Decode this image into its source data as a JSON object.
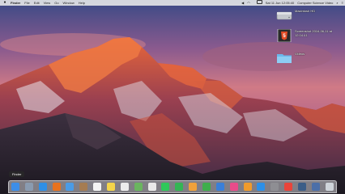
{
  "menubar": {
    "apple_icon": "apple-logo-icon",
    "items": [
      "Finder",
      "File",
      "Edit",
      "View",
      "Go",
      "Window",
      "Help"
    ],
    "clock": "Sat 11 Jun 12:05:40",
    "user": "Computer Science Video",
    "status_icons": [
      "battery-icon",
      "wifi-icon",
      "volume-icon",
      "search-icon",
      "notification-center-icon"
    ]
  },
  "desktop_items": [
    {
      "icon": "hard-drive-icon",
      "label": "Macintosh HD",
      "color": "#b9bcc2"
    },
    {
      "icon": "screenshot-thumbnail-icon",
      "label": "Screenshot 2016-06-11 at 12.04.41",
      "color": "#e34c26"
    },
    {
      "icon": "folder-icon",
      "label": "Videos",
      "color": "#7dc4f0"
    }
  ],
  "tooltip": "Finder",
  "dock": {
    "apps": [
      {
        "name": "finder",
        "icon": "finder-icon",
        "color": "#3d8ee8"
      },
      {
        "name": "launchpad",
        "icon": "rocket-icon",
        "color": "#8a9bb0"
      },
      {
        "name": "safari",
        "icon": "compass-icon",
        "color": "#2f8fe6"
      },
      {
        "name": "firefox",
        "icon": "fox-icon",
        "color": "#e8721e"
      },
      {
        "name": "mail",
        "icon": "envelope-icon",
        "color": "#4a9be6"
      },
      {
        "name": "contacts",
        "icon": "address-book-icon",
        "color": "#a57c52"
      },
      {
        "name": "calendar",
        "icon": "calendar-icon",
        "color": "#f4f4f4"
      },
      {
        "name": "notes",
        "icon": "notes-icon",
        "color": "#f3d44a"
      },
      {
        "name": "reminders",
        "icon": "checklist-icon",
        "color": "#ececec"
      },
      {
        "name": "maps",
        "icon": "map-icon",
        "color": "#6ab55f"
      },
      {
        "name": "photos",
        "icon": "photo-flower-icon",
        "color": "#e9e9e9"
      },
      {
        "name": "messages",
        "icon": "speech-bubble-icon",
        "color": "#2fc85a"
      },
      {
        "name": "facetime",
        "icon": "video-camera-icon",
        "color": "#34b554"
      },
      {
        "name": "pages",
        "icon": "document-icon",
        "color": "#f0a13a"
      },
      {
        "name": "numbers",
        "icon": "bar-chart-icon",
        "color": "#3fae4c"
      },
      {
        "name": "keynote",
        "icon": "podium-icon",
        "color": "#3a7fd8"
      },
      {
        "name": "itunes",
        "icon": "music-note-icon",
        "color": "#e94c8a"
      },
      {
        "name": "ibooks",
        "icon": "book-icon",
        "color": "#f09b2c"
      },
      {
        "name": "app-store",
        "icon": "app-store-icon",
        "color": "#2c8fe7"
      },
      {
        "name": "system-preferences",
        "icon": "gear-icon",
        "color": "#8e8e93"
      },
      {
        "name": "chrome",
        "icon": "chrome-icon",
        "color": "#e9443a"
      },
      {
        "name": "quicktime",
        "icon": "quicktime-icon",
        "color": "#3b5d87"
      },
      {
        "name": "downloads",
        "icon": "downloads-stack-icon",
        "color": "#4c6fa8"
      },
      {
        "name": "trash",
        "icon": "trash-icon",
        "color": "#cfd4da"
      }
    ]
  }
}
